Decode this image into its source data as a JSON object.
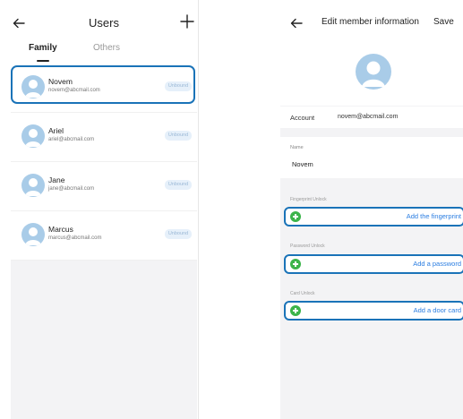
{
  "users_screen": {
    "title": "Users",
    "tabs": [
      {
        "label": "Family",
        "active": true
      },
      {
        "label": "Others",
        "active": false
      }
    ],
    "users": [
      {
        "name": "Novem",
        "email": "novem@abcmail.com",
        "status": "Unbound",
        "highlighted": true
      },
      {
        "name": "Ariel",
        "email": "ariel@abcmail.com",
        "status": "Unbound",
        "highlighted": false
      },
      {
        "name": "Jane",
        "email": "jane@abcmail.com",
        "status": "Unbound",
        "highlighted": false
      },
      {
        "name": "Marcus",
        "email": "marcus@abcmail.com",
        "status": "Unbound",
        "highlighted": false
      }
    ]
  },
  "edit_screen": {
    "title": "Edit member information",
    "save_label": "Save",
    "account_label": "Account",
    "account_value": "novem@abcmail.com",
    "name_label": "Name",
    "name_value": "Novem",
    "sections": [
      {
        "label": "Fingerprint Unlock",
        "action": "Add the fingerprint"
      },
      {
        "label": "Password Unlock",
        "action": "Add a password"
      },
      {
        "label": "Card Unlock",
        "action": "Add a door card"
      }
    ]
  },
  "colors": {
    "highlight": "#1a73b8",
    "action_text": "#2a7de1",
    "add_icon": "#3cb44a",
    "avatar": "#a9cce8"
  }
}
